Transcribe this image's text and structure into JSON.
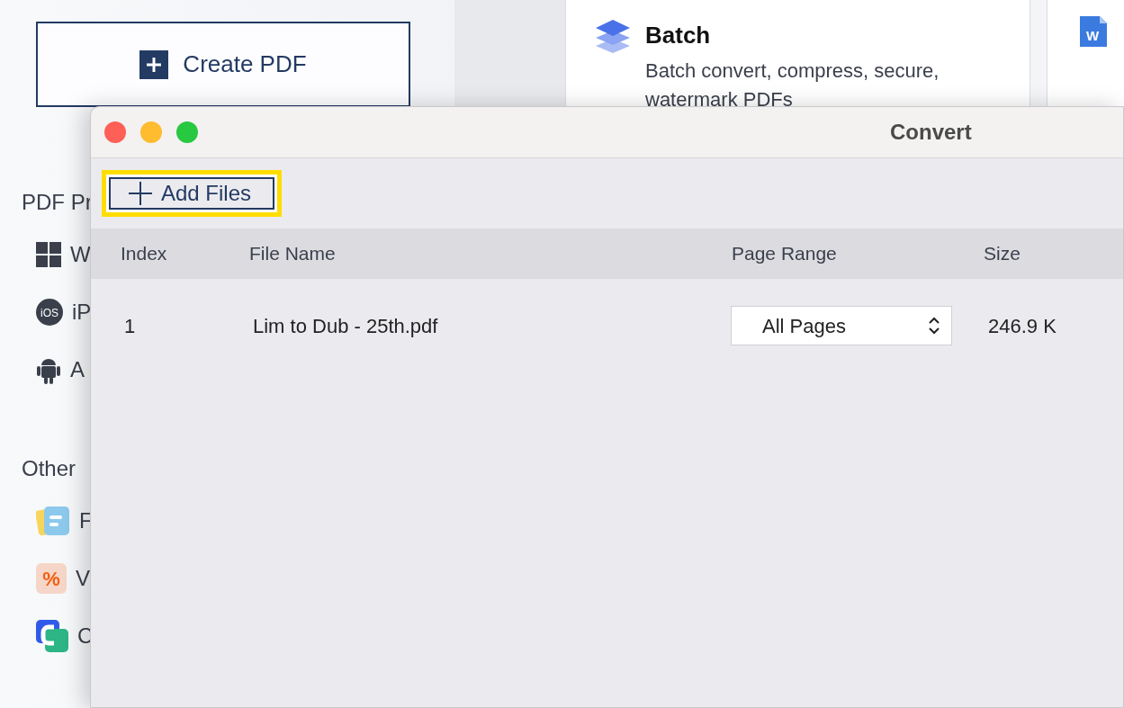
{
  "background_app": {
    "create_button": {
      "label": "Create PDF"
    },
    "sections": [
      {
        "title": "PDF Pr",
        "items": [
          {
            "kind": "windows",
            "label": "W"
          },
          {
            "kind": "ios",
            "glyph": "iOS",
            "label": "iP"
          },
          {
            "kind": "android",
            "label": "A"
          }
        ]
      },
      {
        "title": "Other",
        "items": [
          {
            "kind": "notes",
            "label": "F"
          },
          {
            "kind": "percent",
            "glyph": "%",
            "label": "V"
          },
          {
            "kind": "c-logo",
            "label": "C"
          }
        ]
      }
    ],
    "cards": [
      {
        "kind": "batch",
        "title": "Batch",
        "description": "Batch convert, compress, secure, watermark PDFs"
      },
      {
        "kind": "word",
        "glyph": "W"
      }
    ]
  },
  "window": {
    "title": "Convert",
    "add_button": {
      "label": "Add Files",
      "highlighted": true
    },
    "table": {
      "columns": [
        "Index",
        "File Name",
        "Page Range",
        "Size"
      ],
      "rows": [
        {
          "index": "1",
          "file_name": "Lim to Dub - 25th.pdf",
          "page_range": "All Pages",
          "size": "246.9 K"
        }
      ]
    }
  }
}
